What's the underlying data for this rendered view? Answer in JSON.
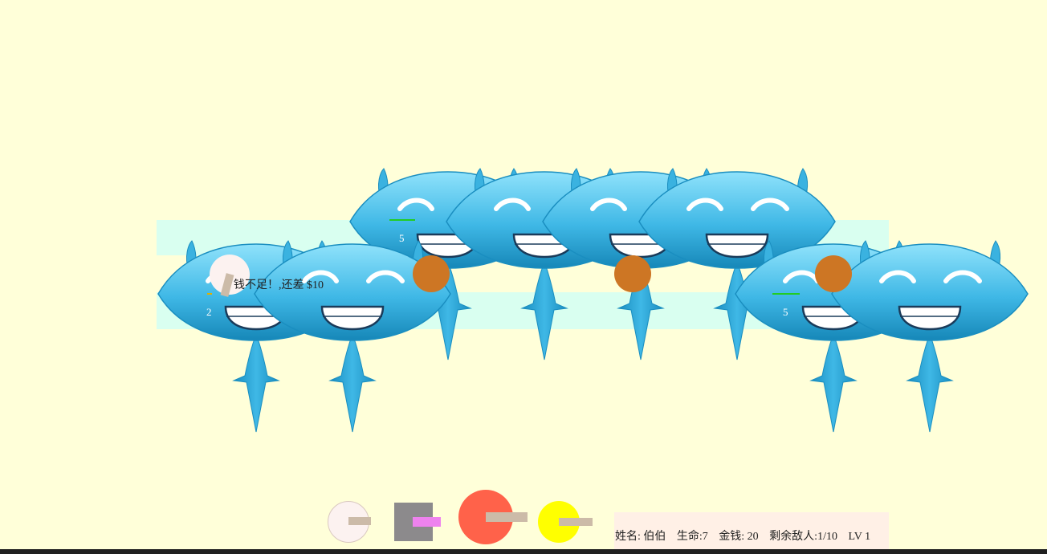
{
  "status": {
    "name_label": "姓名:",
    "name_value": "伯伯",
    "lives_label": "生命:",
    "lives_value": "7",
    "money_label": "金钱:",
    "money_value": "20",
    "enemies_label": "剩余敌人:",
    "enemies_value": "1/10",
    "level": "LV 1"
  },
  "message": "钱不足！,还差 $10",
  "monsters": [
    {
      "id": "monster-1",
      "hp": "2"
    },
    {
      "id": "monster-2",
      "hp": ""
    },
    {
      "id": "monster-3",
      "hp": "5"
    },
    {
      "id": "monster-4",
      "hp": ""
    },
    {
      "id": "monster-5",
      "hp": ""
    },
    {
      "id": "monster-6",
      "hp": ""
    },
    {
      "id": "monster-7",
      "hp": "5"
    },
    {
      "id": "monster-8",
      "hp": ""
    }
  ],
  "towers": [
    {
      "name": "white-tower",
      "color": "#fcf2f0",
      "barrel": "#ccbba8"
    },
    {
      "name": "gray-tower",
      "color": "#8c8a8c",
      "barrel": "#ee82ee"
    },
    {
      "name": "red-tower",
      "color": "#ff624a",
      "barrel": "#ccbba8"
    },
    {
      "name": "yellow-tower",
      "color": "#ffff00",
      "barrel": "#ccbba8"
    }
  ],
  "colors": {
    "background": "#ffffd9",
    "path": "#d9fff0",
    "bullet": "#cd7624",
    "hp_bar": "#22cc22",
    "status_bg": "#fff0e6"
  }
}
